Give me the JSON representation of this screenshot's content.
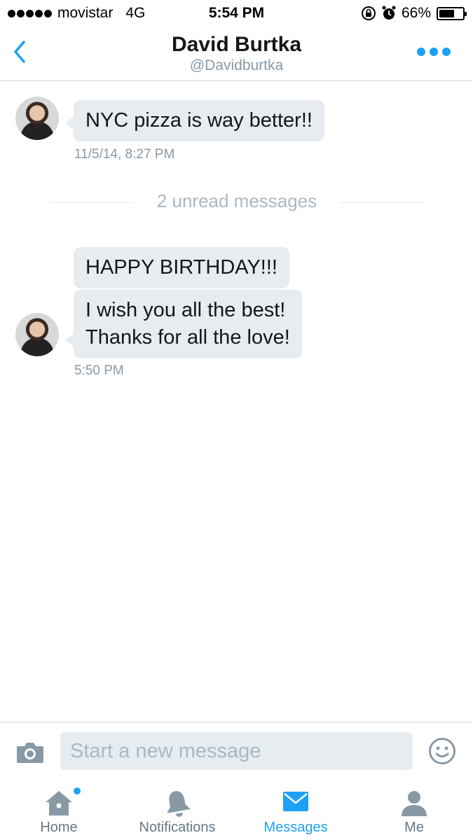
{
  "status_bar": {
    "carrier": "movistar",
    "network": "4G",
    "time": "5:54 PM",
    "battery": "66%",
    "battery_level": 0.66
  },
  "header": {
    "name": "David Burtka",
    "handle": "@Davidburtka"
  },
  "conversation": {
    "older": {
      "text": "NYC pizza is way better!!",
      "timestamp": "11/5/14, 8:27 PM"
    },
    "unread_divider": "2 unread messages",
    "new_messages": [
      {
        "text": "HAPPY BIRTHDAY!!!"
      },
      {
        "line1": "I wish you all the best!",
        "line2": "Thanks for all the love!"
      }
    ],
    "new_timestamp": "5:50 PM"
  },
  "composer": {
    "placeholder": "Start a new message"
  },
  "tabs": [
    {
      "label": "Home",
      "icon": "home-icon",
      "has_dot": true
    },
    {
      "label": "Notifications",
      "icon": "bell-icon"
    },
    {
      "label": "Messages",
      "icon": "envelope-icon",
      "active": true
    },
    {
      "label": "Me",
      "icon": "person-icon"
    }
  ],
  "colors": {
    "accent": "#1da1f2",
    "bubble": "#e6ecf0",
    "muted_text": "#8899a6",
    "tab_inactive": "#657786"
  }
}
